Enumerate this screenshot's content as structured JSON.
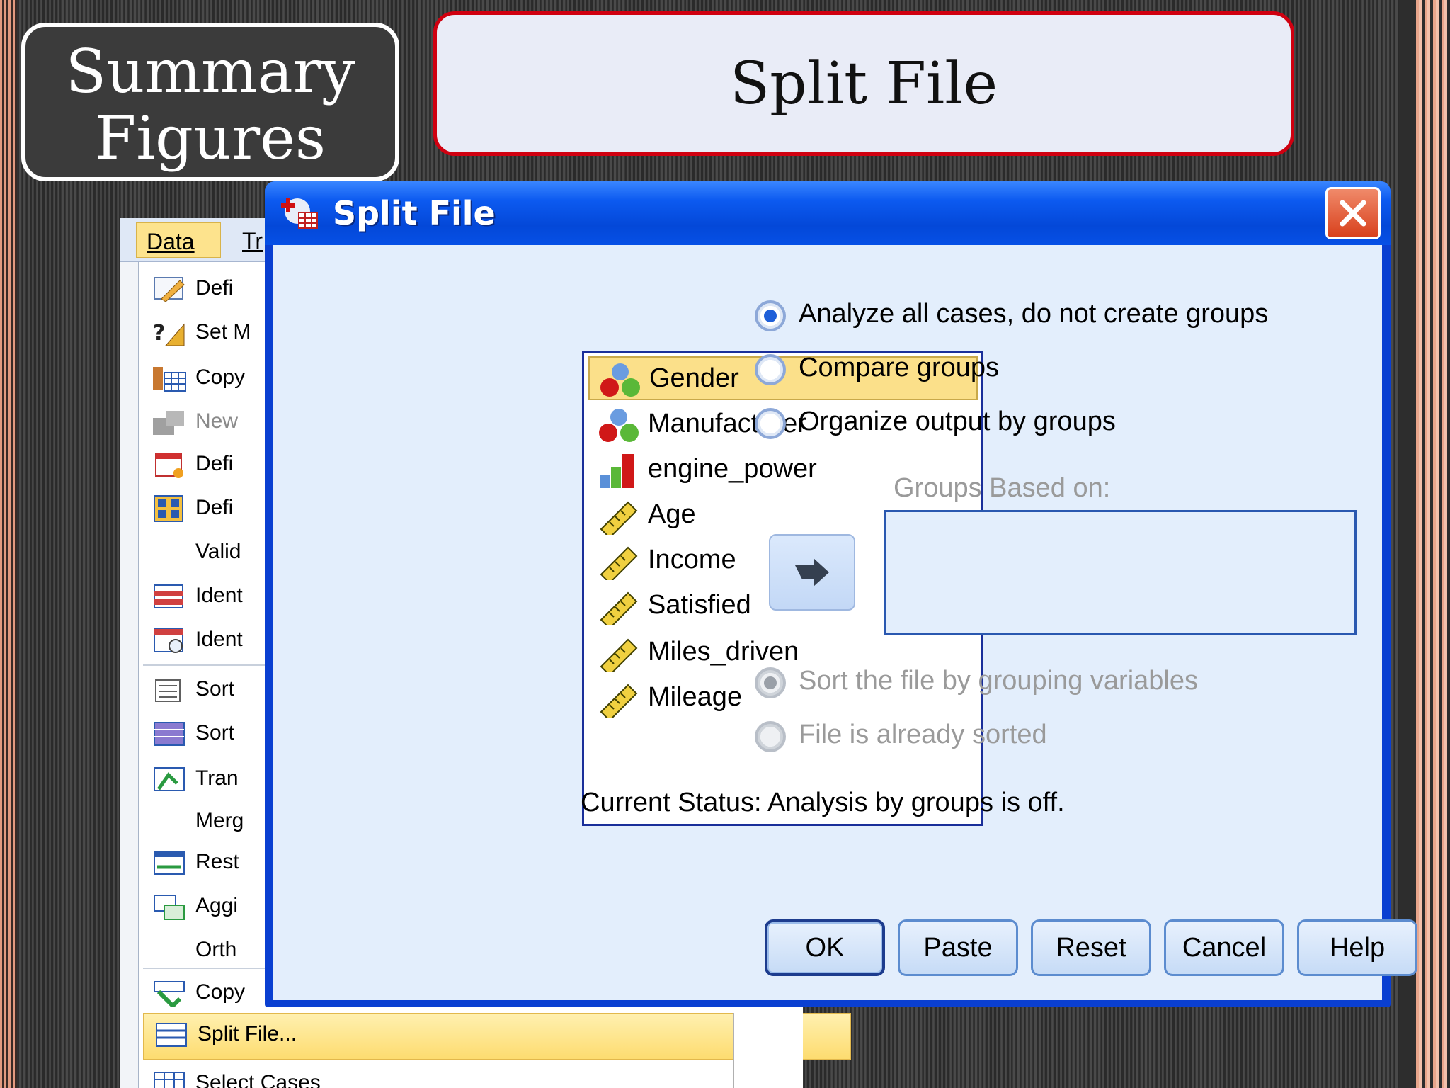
{
  "slide": {
    "summary_line1": "Summary",
    "summary_line2": "Figures",
    "heading": "Split File"
  },
  "menu": {
    "tabs": [
      "Data",
      "Tr"
    ],
    "items": [
      {
        "label": "Defi",
        "icon": "define-variable-properties-icon"
      },
      {
        "label": "Set M",
        "icon": "set-measurement-level-icon"
      },
      {
        "label": "Copy",
        "icon": "copy-data-properties-icon"
      },
      {
        "label": "New",
        "icon": "new-custom-attribute-icon",
        "disabled": true
      },
      {
        "label": "Defi",
        "icon": "define-dates-icon"
      },
      {
        "label": "Defi",
        "icon": "define-multiple-response-icon"
      },
      {
        "label": "Valid",
        "icon": ""
      },
      {
        "label": "Ident",
        "icon": "identify-duplicate-cases-icon"
      },
      {
        "label": "Ident",
        "icon": "identify-unusual-cases-icon"
      },
      {
        "label": "Sort",
        "icon": "sort-cases-icon"
      },
      {
        "label": "Sort",
        "icon": "sort-variables-icon"
      },
      {
        "label": "Tran",
        "icon": "transpose-icon"
      },
      {
        "label": "Merg",
        "icon": ""
      },
      {
        "label": "Rest",
        "icon": "restructure-icon"
      },
      {
        "label": "Aggi",
        "icon": "aggregate-icon"
      },
      {
        "label": "Orth",
        "icon": ""
      },
      {
        "label": "Copy",
        "icon": "copy-dataset-icon"
      },
      {
        "label": "Split File...",
        "icon": "split-file-icon"
      },
      {
        "label": "Select Cases",
        "icon": "select-cases-icon"
      }
    ]
  },
  "dialog": {
    "title": "Split File",
    "variables": [
      {
        "name": "Gender",
        "icon": "nominal-variable-icon"
      },
      {
        "name": "Manufacturer",
        "icon": "nominal-variable-icon"
      },
      {
        "name": "engine_power",
        "icon": "ordinal-variable-icon"
      },
      {
        "name": "Age",
        "icon": "scale-variable-icon"
      },
      {
        "name": "Income",
        "icon": "scale-variable-icon"
      },
      {
        "name": "Satisfied",
        "icon": "scale-variable-icon"
      },
      {
        "name": "Miles_driven",
        "icon": "scale-variable-icon"
      },
      {
        "name": "Mileage",
        "icon": "scale-variable-icon"
      }
    ],
    "options": [
      {
        "label": "Analyze all cases, do not create groups",
        "selected": true
      },
      {
        "label": "Compare groups",
        "selected": false
      },
      {
        "label": "Organize output by groups",
        "selected": false
      }
    ],
    "groups_label": "Groups Based on:",
    "sort_options": [
      {
        "label": "Sort the file by grouping variables",
        "selected": true
      },
      {
        "label": "File is already sorted",
        "selected": false
      }
    ],
    "status": "Current Status: Analysis by groups is off.",
    "buttons": {
      "ok": "OK",
      "paste": "Paste",
      "reset": "Reset",
      "cancel": "Cancel",
      "help": "Help"
    }
  },
  "colors": {
    "title_bar": "#0448d8",
    "selected_row": "#fbe08a",
    "title_border": "#d00010"
  }
}
